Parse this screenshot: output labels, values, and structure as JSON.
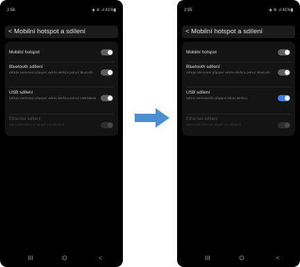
{
  "colors": {
    "accent": "#3f7fe8",
    "background": "#000000",
    "card": "#141414",
    "arrow": "#4b8fd0"
  },
  "screens": [
    {
      "status": {
        "time": "2:56",
        "right": "◈ ≋ .ıl 41%▮"
      },
      "header_title": "< Mobilní hotspot a sdílení",
      "rows": [
        {
          "title": "Mobilní hotspot",
          "desc": "",
          "state": "off"
        },
        {
          "title": "Bluetooth sdílení",
          "desc": "Sdílejte internetové připojení vašeho telefonu pomocí Bluetooth.",
          "state": "off"
        },
        {
          "title": "USB sdílení",
          "desc": "Sdílejte internetové připojení vašeho telefonu pomocí USB kabelu.",
          "state": "off"
        },
        {
          "title": "Ethernet sdílení",
          "desc": "Zapoj USB Ethernet adaptér pro připojení.",
          "state": "disabled"
        }
      ],
      "nav": [
        "III",
        "O",
        "<"
      ]
    },
    {
      "status": {
        "time": "2:55",
        "right": "◈ ≋ .ıl 41%▮"
      },
      "header_title": "< Mobilní hotspot a sdílení",
      "rows": [
        {
          "title": "Mobilní hotspot",
          "desc": "",
          "state": "off"
        },
        {
          "title": "Bluetooth sdílení",
          "desc": "Sdílejte internetové připojení vašeho telefonu pomocí Bluetooth.",
          "state": "off"
        },
        {
          "title": "USB sdílení",
          "desc": "Sdílení internetového připojení tohoto telefonu.",
          "state": "on"
        },
        {
          "title": "Ethernet sdílení",
          "desc": "Zapoj USB Ethernet adaptér pro připojení.",
          "state": "disabled"
        }
      ],
      "nav": [
        "III",
        "O",
        "<"
      ]
    }
  ]
}
